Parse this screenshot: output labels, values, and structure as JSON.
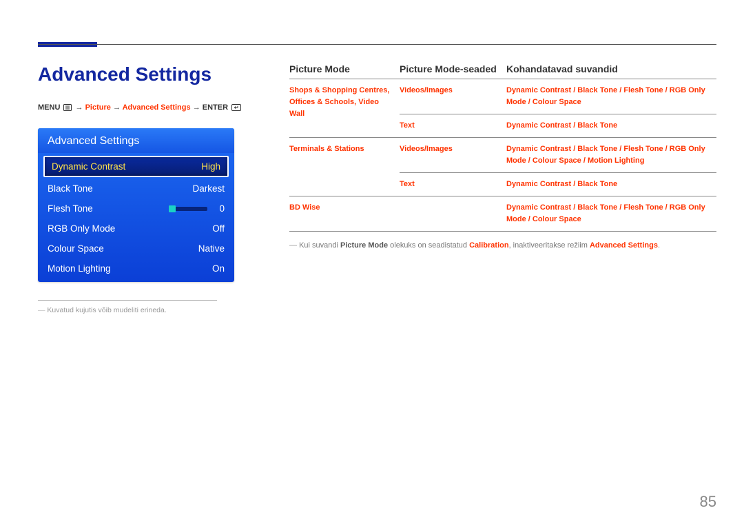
{
  "page_title": "Advanced Settings",
  "breadcrumb": {
    "prefix": "MENU",
    "arrow": "→",
    "seg1": "Picture",
    "seg2": "Advanced Settings",
    "enter": "ENTER"
  },
  "osd": {
    "title": "Advanced Settings",
    "rows": [
      {
        "label": "Dynamic Contrast",
        "value": "High",
        "selected": true
      },
      {
        "label": "Black Tone",
        "value": "Darkest"
      },
      {
        "label": "Flesh Tone",
        "value": "0",
        "slider": true
      },
      {
        "label": "RGB Only Mode",
        "value": "Off"
      },
      {
        "label": "Colour Space",
        "value": "Native"
      },
      {
        "label": "Motion Lighting",
        "value": "On"
      }
    ]
  },
  "footnote_left": "Kuvatud kujutis võib mudeliti erineda.",
  "headers": {
    "c0": "Picture Mode",
    "c1": "Picture Mode-seaded",
    "c2": "Kohandatavad suvandid"
  },
  "table": [
    {
      "c0": "Shops & Shopping Centres, Offices & Schools, Video Wall",
      "c1": "Videos/Images",
      "c2": "Dynamic Contrast / Black Tone / Flesh Tone / RGB Only Mode / Colour Space"
    },
    {
      "c0": "",
      "c1": "Text",
      "c2": "Dynamic Contrast / Black Tone"
    },
    {
      "c0": "Terminals & Stations",
      "c1": "Videos/Images",
      "c2": "Dynamic Contrast / Black Tone / Flesh Tone / RGB Only Mode / Colour Space / Motion Lighting"
    },
    {
      "c0": "",
      "c1": "Text",
      "c2": "Dynamic Contrast / Black Tone"
    },
    {
      "c0": "BD Wise",
      "c1": "",
      "c2": "Dynamic Contrast / Black Tone / Flesh Tone / RGB Only Mode / Colour Space"
    }
  ],
  "note": {
    "t1": "Kui suvandi ",
    "b1": "Picture Mode",
    "t2": " olekuks on seadistatud ",
    "r1": "Calibration",
    "t3": ", inaktiveeritakse režiim ",
    "r2": "Advanced Settings",
    "t4": "."
  },
  "page_number": "85"
}
